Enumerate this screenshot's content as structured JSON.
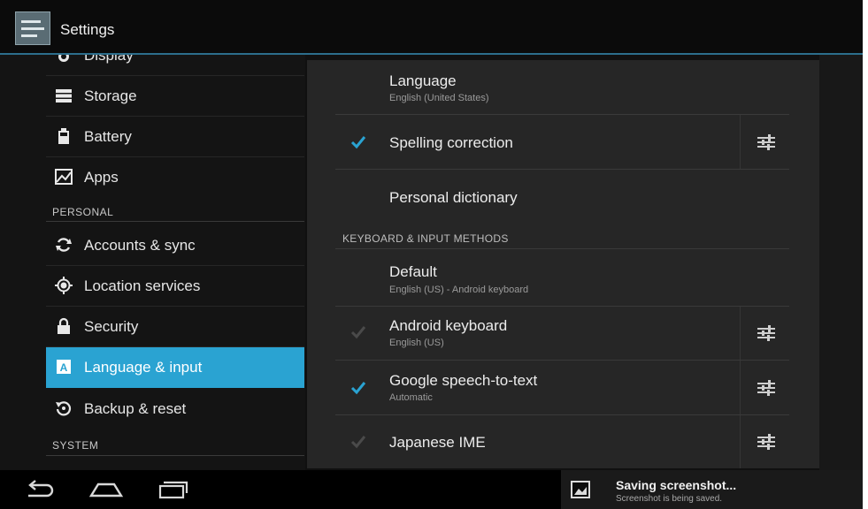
{
  "action_bar": {
    "title": "Settings"
  },
  "sidebar": {
    "items": [
      {
        "label": "Display",
        "icon": "brightness-icon"
      },
      {
        "label": "Storage",
        "icon": "storage-icon"
      },
      {
        "label": "Battery",
        "icon": "battery-icon"
      },
      {
        "label": "Apps",
        "icon": "apps-icon"
      },
      {
        "label": "Accounts & sync",
        "icon": "sync-icon"
      },
      {
        "label": "Location services",
        "icon": "location-icon"
      },
      {
        "label": "Security",
        "icon": "lock-icon"
      },
      {
        "label": "Language & input",
        "icon": "language-icon",
        "selected": true
      },
      {
        "label": "Backup & reset",
        "icon": "backup-icon"
      }
    ],
    "headers": {
      "personal": "PERSONAL",
      "system": "SYSTEM"
    }
  },
  "content": {
    "language": {
      "title": "Language",
      "summary": "English (United States)"
    },
    "spelling": {
      "title": "Spelling correction",
      "checked": true
    },
    "dictionary": {
      "title": "Personal dictionary"
    },
    "category": "KEYBOARD & INPUT METHODS",
    "default": {
      "title": "Default",
      "summary": "English (US) - Android keyboard"
    },
    "android_keyboard": {
      "title": "Android keyboard",
      "summary": "English (US)",
      "checked": true,
      "enabled": false
    },
    "google_speech": {
      "title": "Google speech-to-text",
      "summary": "Automatic",
      "checked": true
    },
    "japanese_ime": {
      "title": "Japanese IME",
      "checked": true,
      "enabled": false
    }
  },
  "notification": {
    "title": "Saving screenshot...",
    "text": "Screenshot is being saved."
  },
  "colors": {
    "accent": "#2aa3d2",
    "background": "#101010",
    "panel": "#262626"
  }
}
